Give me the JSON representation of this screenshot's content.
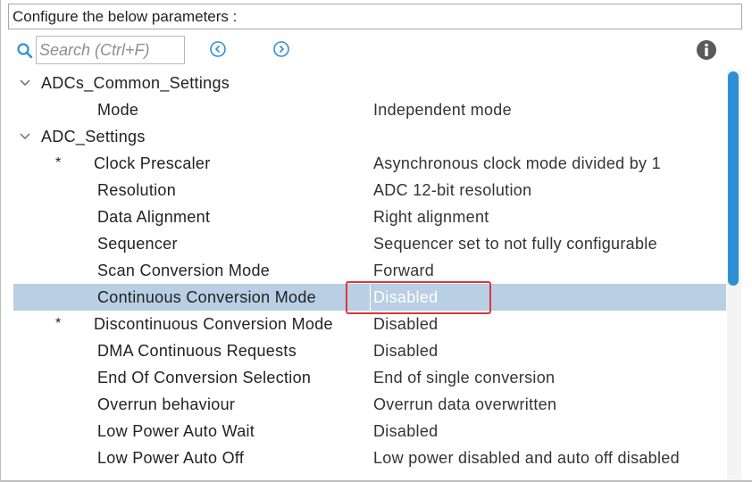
{
  "header": {
    "title": "Configure the below parameters :"
  },
  "toolbar": {
    "search_placeholder": "Search (Ctrl+F)",
    "accent_color": "#2e8fd6",
    "icons": [
      "search-icon",
      "previous-icon",
      "next-icon",
      "info-icon"
    ]
  },
  "tree": {
    "groups": [
      {
        "label": "ADCs_Common_Settings",
        "expanded": true
      },
      {
        "label": "ADC_Settings",
        "expanded": true
      }
    ],
    "rows": [
      {
        "param": "Mode",
        "value": "Independent mode"
      },
      {
        "star": "*",
        "param": "Clock Prescaler",
        "value": "Asynchronous clock mode divided by 1"
      },
      {
        "param": "Resolution",
        "value": "ADC 12-bit resolution"
      },
      {
        "param": "Data Alignment",
        "value": "Right alignment"
      },
      {
        "param": "Sequencer",
        "value": "Sequencer set to not fully configurable"
      },
      {
        "param": "Scan Conversion Mode",
        "value": "Forward"
      },
      {
        "param": "Continuous Conversion Mode",
        "value": "Disabled",
        "selected": true
      },
      {
        "star": "*",
        "param": "Discontinuous Conversion Mode",
        "value": "Disabled"
      },
      {
        "param": "DMA Continuous Requests",
        "value": "Disabled"
      },
      {
        "param": "End Of Conversion Selection",
        "value": "End of single conversion"
      },
      {
        "param": "Overrun behaviour",
        "value": "Overrun data overwritten"
      },
      {
        "param": "Low Power Auto Wait",
        "value": "Disabled"
      },
      {
        "param": "Low Power Auto Off",
        "value": "Low power disabled and auto off disabled"
      }
    ]
  },
  "colors": {
    "selection": "#b8cfe4",
    "highlight_border": "#e0353b",
    "scrollbar": "#2e8fd6"
  },
  "scroll": {
    "position_fraction": 0.0
  }
}
